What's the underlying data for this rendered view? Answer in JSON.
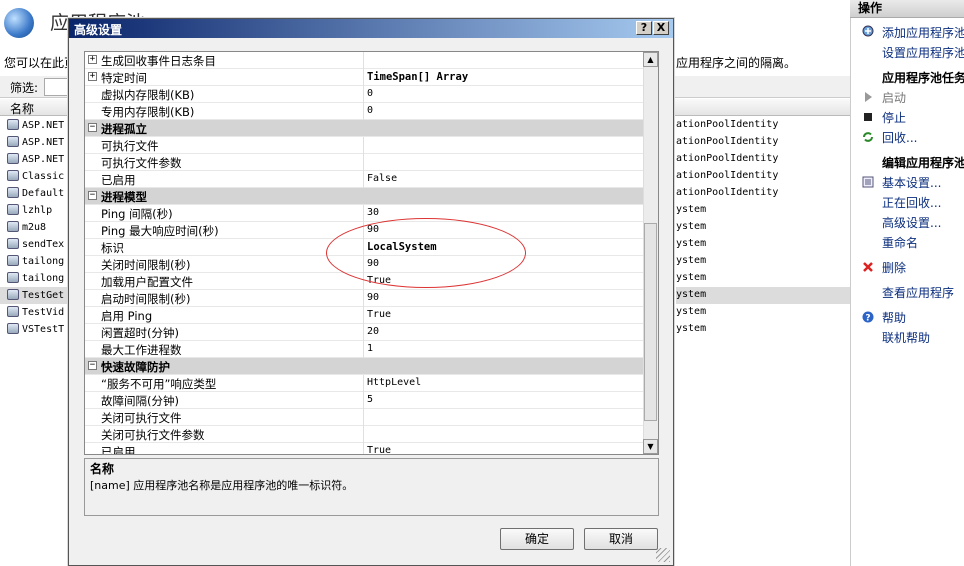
{
  "background": {
    "title": "应用程序池",
    "desc_left": "您可以在此页",
    "desc_right": "应用程序之间的隔离。",
    "filter_label": "筛选:",
    "col_name": "名称",
    "pools": [
      {
        "name": "ASP.NET",
        "identity": "ationPoolIdentity"
      },
      {
        "name": "ASP.NET",
        "identity": "ationPoolIdentity"
      },
      {
        "name": "ASP.NET",
        "identity": "ationPoolIdentity"
      },
      {
        "name": "Classic",
        "identity": "ationPoolIdentity"
      },
      {
        "name": "Default",
        "identity": "ationPoolIdentity"
      },
      {
        "name": "lzhlp",
        "identity": "ystem"
      },
      {
        "name": "m2u8",
        "identity": "ystem"
      },
      {
        "name": "sendTex",
        "identity": "ystem"
      },
      {
        "name": "tailong",
        "identity": "ystem"
      },
      {
        "name": "tailong",
        "identity": "ystem"
      },
      {
        "name": "TestGet",
        "identity": "ystem"
      },
      {
        "name": "TestVid",
        "identity": "ystem"
      },
      {
        "name": "VSTestT",
        "identity": "ystem"
      }
    ]
  },
  "actions": {
    "header": "操作",
    "add_pool": "添加应用程序池",
    "set_defaults": "设置应用程序池",
    "tasks_header": "应用程序池任务",
    "start": "启动",
    "stop": "停止",
    "recycle": "回收...",
    "edit_header": "编辑应用程序池",
    "basic": "基本设置...",
    "recycling": "正在回收...",
    "advanced": "高级设置...",
    "rename": "重命名",
    "delete": "删除",
    "view_apps": "查看应用程序",
    "help": "帮助",
    "online_help": "联机帮助"
  },
  "dialog": {
    "title": "高级设置",
    "help_btn": "?",
    "close_btn": "X",
    "rows": [
      {
        "type": "prop",
        "name": "生成回收事件日志条目",
        "value": "",
        "expander": "+"
      },
      {
        "type": "prop",
        "name": "特定时间",
        "value": "TimeSpan[] Array",
        "expander": "+",
        "bold": true
      },
      {
        "type": "prop",
        "name": "虚拟内存限制(KB)",
        "value": "0"
      },
      {
        "type": "prop",
        "name": "专用内存限制(KB)",
        "value": "0"
      },
      {
        "type": "cat",
        "name": "进程孤立",
        "expander": "-"
      },
      {
        "type": "prop",
        "name": "可执行文件",
        "value": ""
      },
      {
        "type": "prop",
        "name": "可执行文件参数",
        "value": ""
      },
      {
        "type": "prop",
        "name": "已启用",
        "value": "False"
      },
      {
        "type": "cat",
        "name": "进程模型",
        "expander": "-"
      },
      {
        "type": "prop",
        "name": "Ping 间隔(秒)",
        "value": "30"
      },
      {
        "type": "prop",
        "name": "Ping 最大响应时间(秒)",
        "value": "90"
      },
      {
        "type": "prop",
        "name": "标识",
        "value": "LocalSystem",
        "bold": true
      },
      {
        "type": "prop",
        "name": "关闭时间限制(秒)",
        "value": "90"
      },
      {
        "type": "prop",
        "name": "加载用户配置文件",
        "value": "True"
      },
      {
        "type": "prop",
        "name": "启动时间限制(秒)",
        "value": "90"
      },
      {
        "type": "prop",
        "name": "启用 Ping",
        "value": "True"
      },
      {
        "type": "prop",
        "name": "闲置超时(分钟)",
        "value": "20"
      },
      {
        "type": "prop",
        "name": "最大工作进程数",
        "value": "1"
      },
      {
        "type": "cat",
        "name": "快速故障防护",
        "expander": "-"
      },
      {
        "type": "prop",
        "name": "“服务不可用”响应类型",
        "value": "HttpLevel"
      },
      {
        "type": "prop",
        "name": "故障间隔(分钟)",
        "value": "5"
      },
      {
        "type": "prop",
        "name": "关闭可执行文件",
        "value": ""
      },
      {
        "type": "prop",
        "name": "关闭可执行文件参数",
        "value": ""
      },
      {
        "type": "prop",
        "name": "已启用",
        "value": "True"
      }
    ],
    "desc_title": "名称",
    "desc_text": "[name] 应用程序池名称是应用程序池的唯一标识符。",
    "ok": "确定",
    "cancel": "取消"
  }
}
